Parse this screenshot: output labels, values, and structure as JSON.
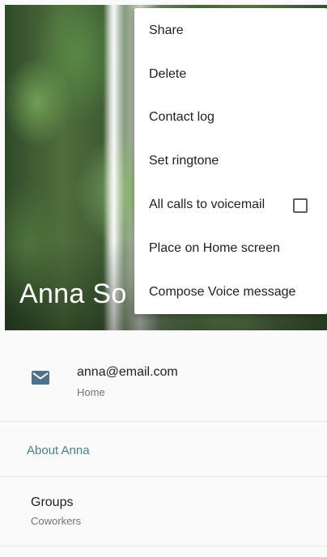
{
  "header": {
    "contact_name": "Anna So"
  },
  "overflow_menu": {
    "items": [
      {
        "label": "Share"
      },
      {
        "label": "Delete"
      },
      {
        "label": "Contact log"
      },
      {
        "label": "Set ringtone"
      },
      {
        "label": "All calls to voicemail",
        "checked": false
      },
      {
        "label": "Place on Home screen"
      },
      {
        "label": "Compose Voice message"
      }
    ]
  },
  "email": {
    "icon": "email-icon",
    "value": "anna@email.com",
    "type": "Home"
  },
  "about": {
    "heading": "About Anna"
  },
  "groups": {
    "label": "Groups",
    "value": "Coworkers"
  },
  "colors": {
    "accent": "#4e7d8a",
    "email_icon": "#4f6f8a"
  }
}
